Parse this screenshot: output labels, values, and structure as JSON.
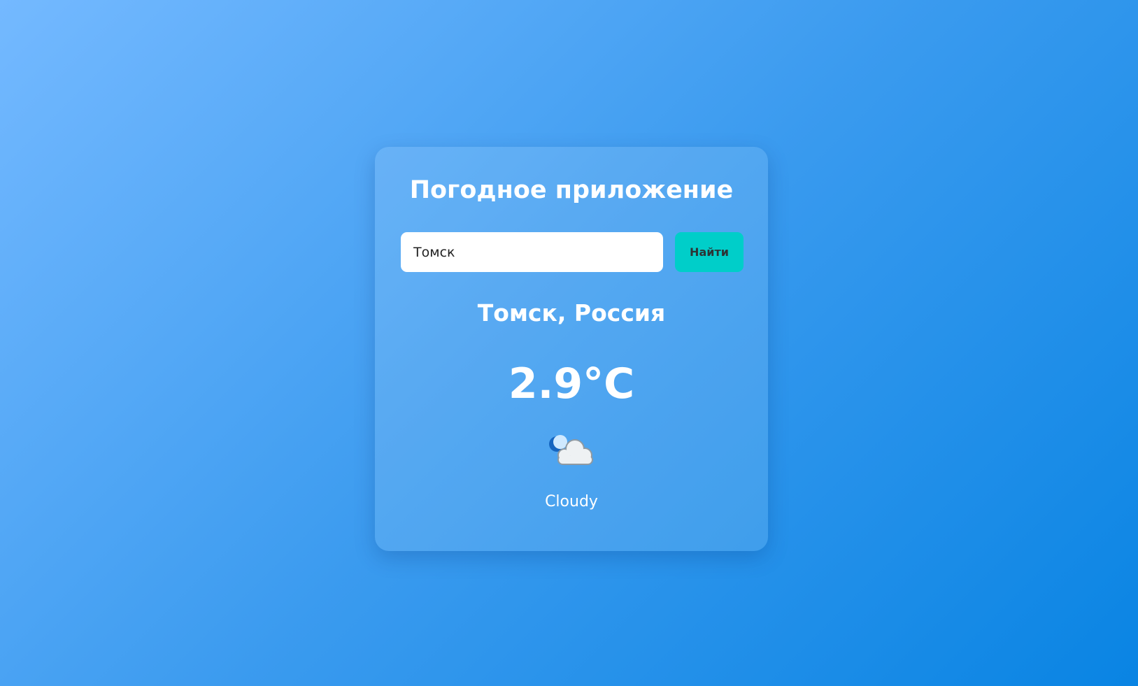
{
  "app": {
    "title": "Погодное приложение"
  },
  "search": {
    "value": "Томск",
    "button_label": "Найти"
  },
  "weather": {
    "location": "Томск, Россия",
    "temperature": "2.9°C",
    "icon": "night-cloudy-icon",
    "description": "Cloudy"
  },
  "colors": {
    "background_start": "#74b9ff",
    "background_end": "#0984e3",
    "button": "#00cec9",
    "button_text": "#2d3436",
    "text": "#ffffff"
  }
}
